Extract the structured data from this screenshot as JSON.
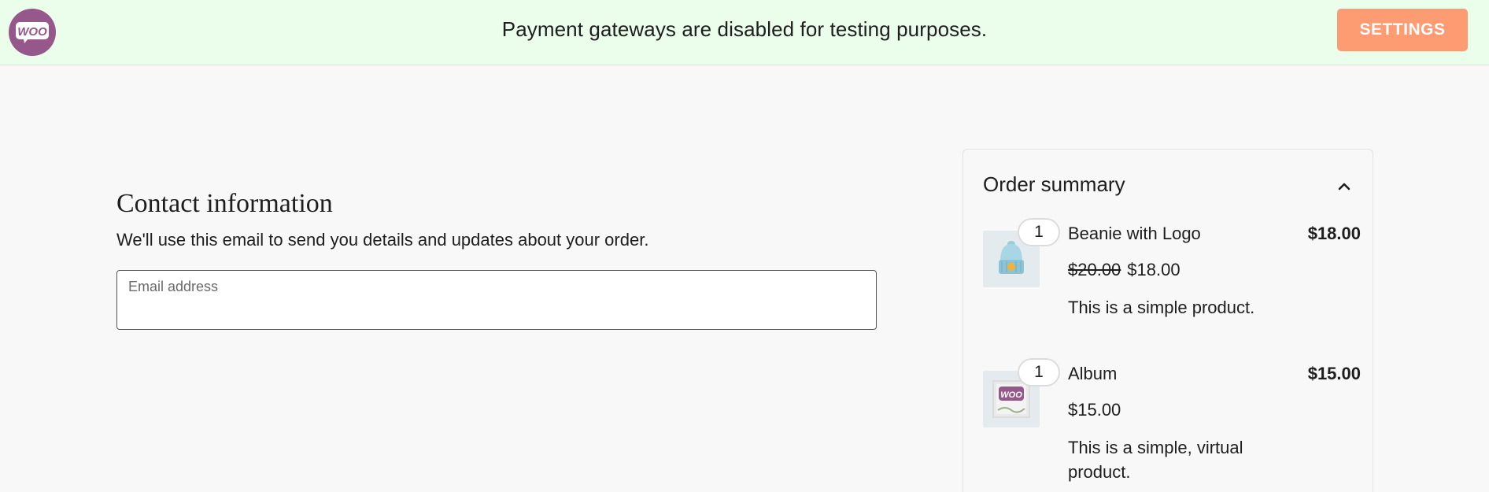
{
  "notice": {
    "logo_text": "WOO",
    "message": "Payment gateways are disabled for testing purposes.",
    "settings_label": "SETTINGS"
  },
  "contact": {
    "title": "Contact information",
    "description": "We'll use this email to send you details and updates about your order.",
    "email_label": "Email address",
    "email_value": ""
  },
  "summary": {
    "title": "Order summary",
    "toggle_icon": "chevron-up-icon",
    "items": [
      {
        "quantity": "1",
        "name": "Beanie with Logo",
        "total": "$18.00",
        "regular_price": "$20.00",
        "sale_price": "$18.00",
        "description": "This is a simple product.",
        "thumbnail_icon": "beanie-icon"
      },
      {
        "quantity": "1",
        "name": "Album",
        "total": "$15.00",
        "regular_price": "",
        "sale_price": "$15.00",
        "description": "This is a simple, virtual product.",
        "thumbnail_icon": "album-icon",
        "thumbnail_text": "WOO"
      }
    ]
  },
  "colors": {
    "notice_bg": "#ebfdeb",
    "brand_purple": "#96588a",
    "settings_button": "#fd9b72"
  }
}
